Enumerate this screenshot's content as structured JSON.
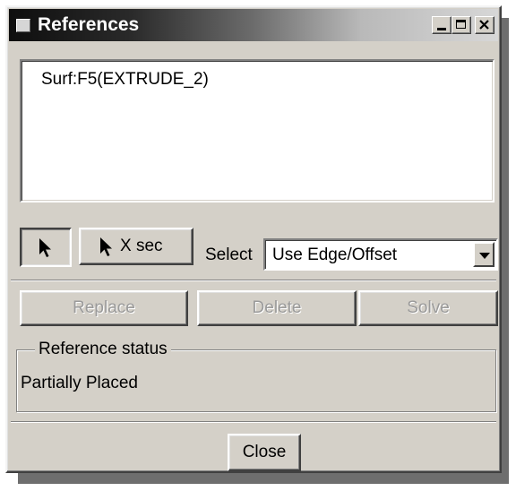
{
  "window": {
    "title": "References",
    "controls": {
      "minimize": "minimize",
      "maximize": "maximize",
      "close": "close"
    }
  },
  "references": {
    "items": [
      "Surf:F5(EXTRUDE_2)"
    ]
  },
  "toolbar": {
    "xsec_label": "X sec",
    "select_label": "Select",
    "select_value": "Use Edge/Offset"
  },
  "actions": {
    "replace_label": "Replace",
    "delete_label": "Delete",
    "solve_label": "Solve"
  },
  "status": {
    "group_label": "Reference status",
    "value": "Partially Placed"
  },
  "footer": {
    "close_label": "Close"
  },
  "icons": {
    "title": "window-icon",
    "pick": "arrow-cursor-icon",
    "xsec": "arrow-cursor-icon"
  }
}
